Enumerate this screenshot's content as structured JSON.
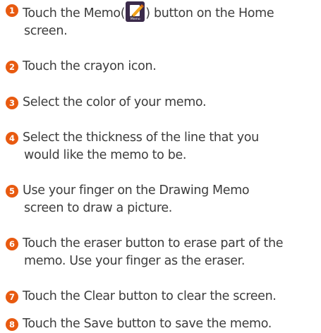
{
  "colors": {
    "badge": "#e85a10",
    "text": "#3c3c3c"
  },
  "steps": [
    {
      "number": "1",
      "before_icon": "Touch the Memo(",
      "icon": {
        "name": "memo-app-icon",
        "label": "Memo"
      },
      "after_icon": ") button on the Home",
      "line2": "screen."
    },
    {
      "number": "2",
      "text": "Touch the crayon icon."
    },
    {
      "number": "3",
      "text": "Select the color of your memo."
    },
    {
      "number": "4",
      "text": "Select the thickness of the line that you",
      "line2": "would like the memo to be."
    },
    {
      "number": "5",
      "text": "Use your finger on the Drawing Memo",
      "line2": "screen to draw a picture."
    },
    {
      "number": "6",
      "text": "Touch the eraser button to erase part of the",
      "line2": "memo. Use your finger as the eraser."
    },
    {
      "number": "7",
      "text": "Touch the Clear button to clear the screen."
    },
    {
      "number": "8",
      "text": "Touch the Save button to save the memo."
    }
  ]
}
